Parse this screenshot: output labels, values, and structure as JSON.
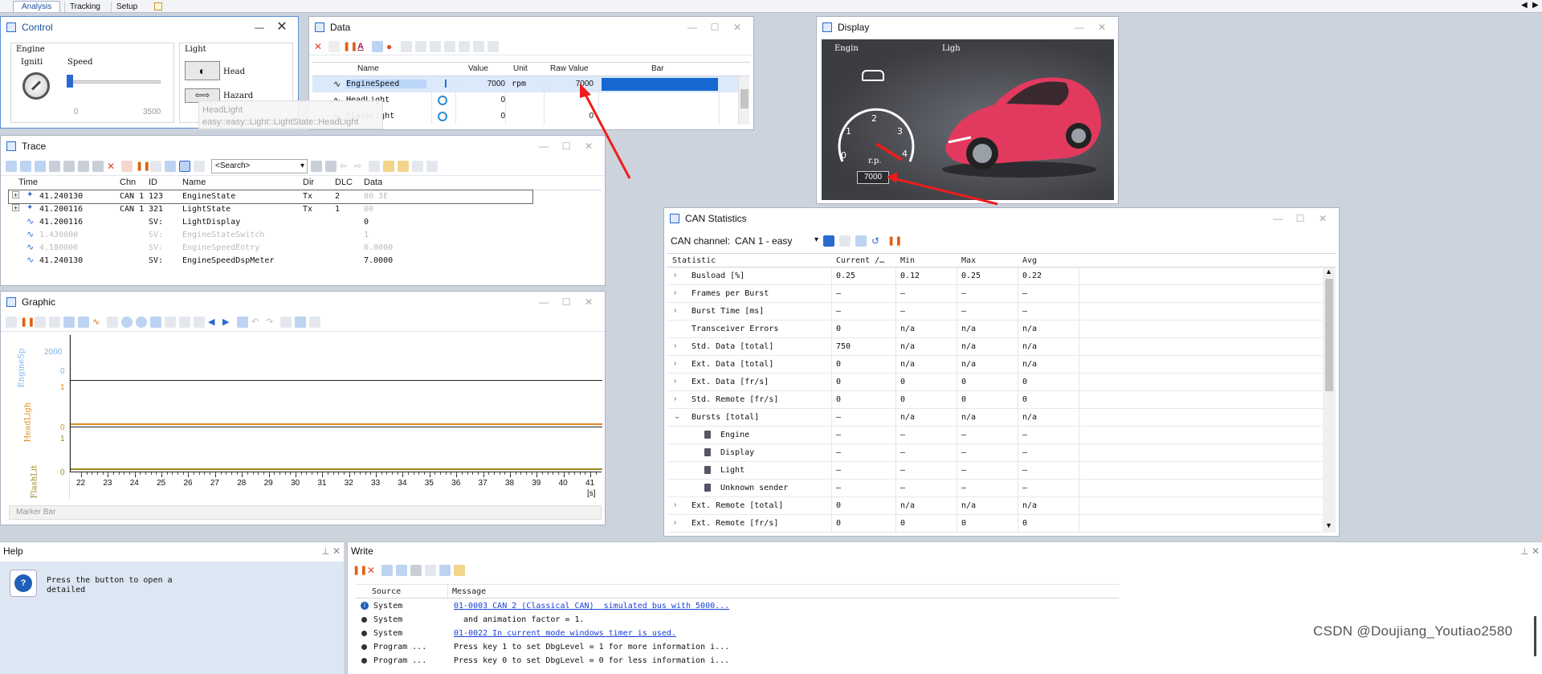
{
  "top_tabs": [
    "Analysis",
    "Tracking",
    "Setup"
  ],
  "control": {
    "title": "Control",
    "engine_group": "Engine",
    "ignition_label": "Igniti",
    "speed_label": "Speed",
    "speed_min": "0",
    "speed_max": "3500",
    "light_group": "Light",
    "head_label": "Head",
    "hazard_label": "Hazard",
    "tooltip_line1": "HeadLight",
    "tooltip_line2": "easy::easy::Light::LightState::HeadLight"
  },
  "data_win": {
    "title": "Data",
    "columns": [
      "Name",
      "Value",
      "Unit",
      "Raw Value",
      "Bar"
    ],
    "rows": [
      {
        "name": "EngineSpeed",
        "value": "7000",
        "unit": "rpm",
        "raw": "7000",
        "bar_fraction": 1.0
      },
      {
        "name": "HeadLight",
        "value": "0",
        "unit": "",
        "raw": "",
        "bar_fraction": 0
      },
      {
        "name": "FlashLight",
        "value": "0",
        "unit": "",
        "raw": "0",
        "bar_fraction": 0
      }
    ]
  },
  "display": {
    "title": "Display",
    "engine_label": "Engin",
    "light_label": "Ligh",
    "gauge_ticks": [
      "0",
      "1",
      "2",
      "3",
      "4"
    ],
    "gauge_unit": "r.p.",
    "rpm_value": "7000"
  },
  "trace": {
    "title": "Trace",
    "search_placeholder": "<Search>",
    "columns": [
      "Time",
      "Chn",
      "ID",
      "Name",
      "Dir",
      "DLC",
      "Data"
    ],
    "rows": [
      {
        "time": "41.240130",
        "chn": "CAN 1",
        "id": "123",
        "name": "EngineState",
        "dir": "Tx",
        "dlc": "2",
        "data": "80 3E",
        "dim": false
      },
      {
        "time": "41.200116",
        "chn": "CAN 1",
        "id": "321",
        "name": "LightState",
        "dir": "Tx",
        "dlc": "1",
        "data": "00",
        "dim": false
      },
      {
        "time": "41.200116",
        "chn": "",
        "id": "SV:",
        "name": "LightDisplay",
        "dir": "",
        "dlc": "",
        "data": "0",
        "dim": false
      },
      {
        "time": "1.430000",
        "chn": "",
        "id": "SV:",
        "name": "EngineStateSwitch",
        "dir": "",
        "dlc": "",
        "data": "1",
        "dim": true
      },
      {
        "time": "4.180000",
        "chn": "",
        "id": "SV:",
        "name": "EngineSpeedEntry",
        "dir": "",
        "dlc": "",
        "data": "0.0000",
        "dim": true
      },
      {
        "time": "41.240130",
        "chn": "",
        "id": "SV:",
        "name": "EngineSpeedDspMeter",
        "dir": "",
        "dlc": "",
        "data": "7.0000",
        "dim": false
      }
    ]
  },
  "graphic": {
    "title": "Graphic",
    "signals": [
      {
        "name": "EngineSp",
        "color": "#7fb2e6",
        "ticks": [
          "2000",
          "0"
        ]
      },
      {
        "name": "HeadLigh",
        "color": "#e08a1e",
        "ticks": [
          "1",
          "0"
        ]
      },
      {
        "name": "FlashLit",
        "color": "#9a8a20",
        "ticks": [
          "1",
          "0"
        ]
      }
    ],
    "x_ticks": [
      "22",
      "23",
      "24",
      "25",
      "26",
      "27",
      "28",
      "29",
      "30",
      "31",
      "32",
      "33",
      "34",
      "35",
      "36",
      "37",
      "38",
      "39",
      "40",
      "41"
    ],
    "x_unit": "[s]",
    "marker_bar": "Marker Bar"
  },
  "can_stats": {
    "title": "CAN Statistics",
    "channel_label": "CAN channel:",
    "channel_value": "CAN 1 - easy",
    "columns": [
      "Statistic",
      "Current /…",
      "Min",
      "Max",
      "Avg"
    ],
    "rows": [
      {
        "label": "Busload [%]",
        "exp": ">",
        "indent": 0,
        "cur": "0.25",
        "min": "0.12",
        "max": "0.25",
        "avg": "0.22"
      },
      {
        "label": "Frames per Burst",
        "exp": ">",
        "indent": 0,
        "cur": "–",
        "min": "–",
        "max": "–",
        "avg": "–"
      },
      {
        "label": "Burst Time [ms]",
        "exp": ">",
        "indent": 0,
        "cur": "–",
        "min": "–",
        "max": "–",
        "avg": "–"
      },
      {
        "label": "Transceiver Errors",
        "exp": "",
        "indent": 0,
        "cur": "0",
        "min": "n/a",
        "max": "n/a",
        "avg": "n/a"
      },
      {
        "label": "Std. Data [total]",
        "exp": ">",
        "indent": 0,
        "cur": "750",
        "min": "n/a",
        "max": "n/a",
        "avg": "n/a"
      },
      {
        "label": "Ext. Data [total]",
        "exp": ">",
        "indent": 0,
        "cur": "0",
        "min": "n/a",
        "max": "n/a",
        "avg": "n/a"
      },
      {
        "label": "Ext. Data [fr/s]",
        "exp": ">",
        "indent": 0,
        "cur": "0",
        "min": "0",
        "max": "0",
        "avg": "0"
      },
      {
        "label": "Std. Remote [fr/s]",
        "exp": ">",
        "indent": 0,
        "cur": "0",
        "min": "0",
        "max": "0",
        "avg": "0"
      },
      {
        "label": "Bursts [total]",
        "exp": "v",
        "indent": 0,
        "cur": "–",
        "min": "n/a",
        "max": "n/a",
        "avg": "n/a"
      },
      {
        "label": "Engine",
        "exp": "",
        "indent": 1,
        "cur": "–",
        "min": "–",
        "max": "–",
        "avg": "–"
      },
      {
        "label": "Display",
        "exp": "",
        "indent": 1,
        "cur": "–",
        "min": "–",
        "max": "–",
        "avg": "–"
      },
      {
        "label": "Light",
        "exp": "",
        "indent": 1,
        "cur": "–",
        "min": "–",
        "max": "–",
        "avg": "–"
      },
      {
        "label": "Unknown sender",
        "exp": "",
        "indent": 1,
        "cur": "–",
        "min": "–",
        "max": "–",
        "avg": "–"
      },
      {
        "label": "Ext. Remote [total]",
        "exp": ">",
        "indent": 0,
        "cur": "0",
        "min": "n/a",
        "max": "n/a",
        "avg": "n/a"
      },
      {
        "label": "Ext. Remote [fr/s]",
        "exp": ">",
        "indent": 0,
        "cur": "0",
        "min": "0",
        "max": "0",
        "avg": "0"
      }
    ]
  },
  "help": {
    "title": "Help",
    "text": "Press the button to open a detailed"
  },
  "write": {
    "title": "Write",
    "columns": [
      "Source",
      "Message"
    ],
    "rows": [
      {
        "source": "System",
        "message": "01-0003 CAN 2 (Classical CAN)  simulated bus with 5000...",
        "link": true,
        "icon": "info"
      },
      {
        "source": "System",
        "message": "  and animation factor = 1.",
        "link": false,
        "icon": "dot"
      },
      {
        "source": "System",
        "message": "01-0022 In current mode windows timer is used.",
        "link": true,
        "icon": "dot"
      },
      {
        "source": "Program ...",
        "message": "Press key 1 to set DbgLevel = 1 for more information i...",
        "link": false,
        "icon": "dot"
      },
      {
        "source": "Program ...",
        "message": "Press key 0 to set DbgLevel = 0 for less information i...",
        "link": false,
        "icon": "dot"
      }
    ]
  },
  "watermark": "CSDN @Doujiang_Youtiao2580"
}
